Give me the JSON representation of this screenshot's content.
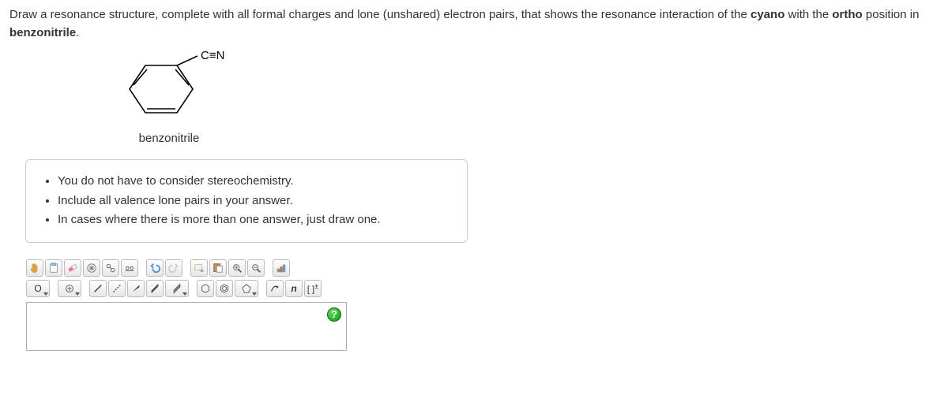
{
  "question": {
    "pre": "Draw a resonance structure, complete with all formal charges and lone (unshared) electron pairs, that shows the resonance interaction of the ",
    "b1": "cyano",
    "mid1": " with the ",
    "b2": "ortho",
    "mid2": " position in ",
    "b3": "benzonitrile",
    "post": "."
  },
  "molecule": {
    "label": "benzonitrile",
    "cn_label": "C≡N"
  },
  "hints": {
    "items": [
      "You do not have to consider stereochemistry.",
      "Include all valence lone pairs in your answer.",
      "In cases where there is more than one answer, just draw one."
    ]
  },
  "toolbar": {
    "row1": {
      "hand": "✋",
      "clipboard": "📋",
      "eraser": "erase",
      "move": "move",
      "link": "link",
      "clean": "clean",
      "undo": "↶",
      "redo": "↷",
      "lasso": "lasso",
      "paste": "paste",
      "zoom_in": "+",
      "zoom_out": "−",
      "prefs": "prefs"
    },
    "row2": {
      "atom_O": "O",
      "add": "⊕",
      "bond_single": "/",
      "bond_dashed": "…",
      "bond_double": "//",
      "bond_triple": "///",
      "hexagon": "⬡",
      "hexagon2": "⬡",
      "pentagon": "⬠",
      "curved_arrow": "↝",
      "no_change": "n",
      "bracket": "[ ]",
      "charge": "±"
    }
  },
  "help": "?"
}
